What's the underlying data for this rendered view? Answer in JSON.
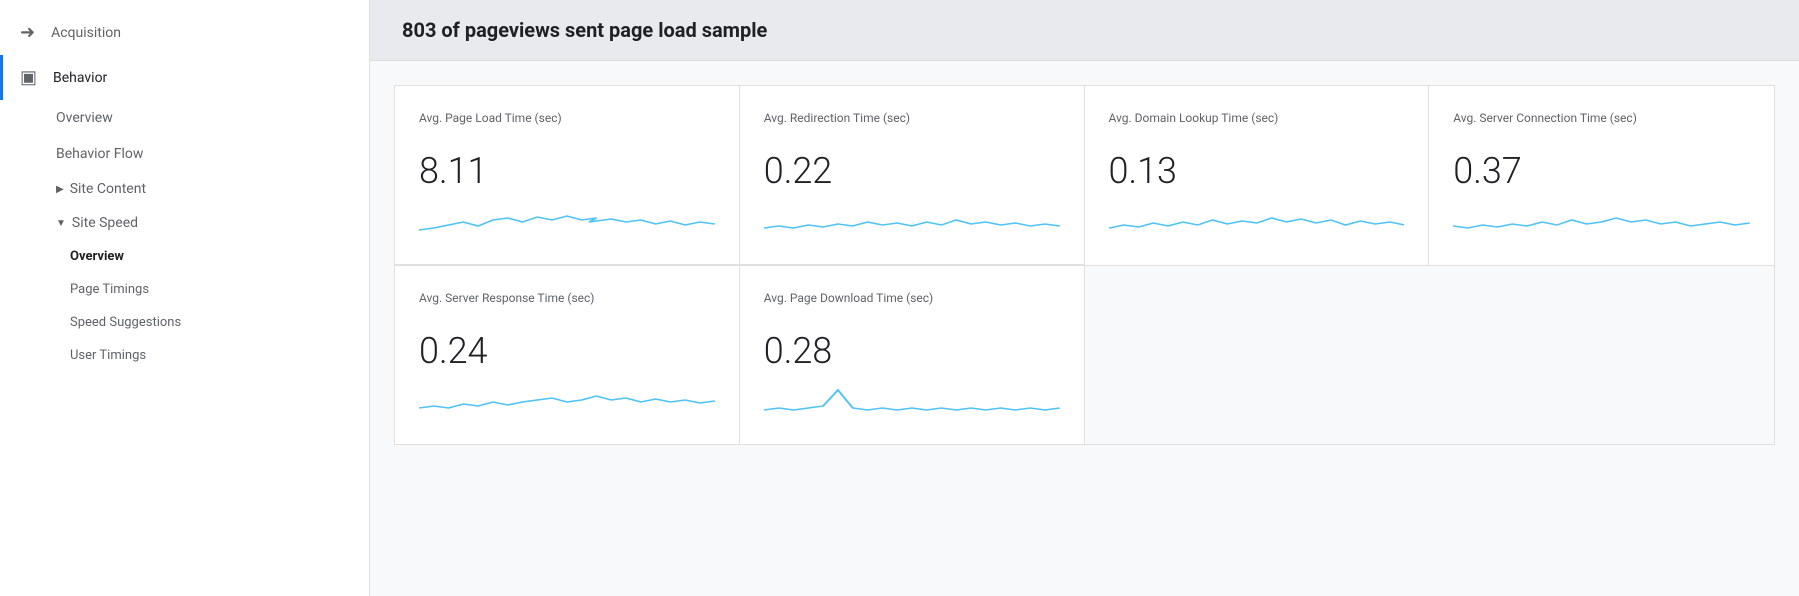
{
  "sidebar": {
    "acquisition": {
      "label": "Acquisition",
      "icon": "→"
    },
    "behavior": {
      "label": "Behavior",
      "icon": "⊞",
      "items": {
        "overview": "Overview",
        "behavior_flow": "Behavior Flow",
        "site_content": "Site Content",
        "site_speed": "Site Speed",
        "site_speed_sub": {
          "overview": "Overview",
          "page_timings": "Page Timings",
          "speed_suggestions": "Speed Suggestions",
          "user_timings": "User Timings"
        }
      }
    }
  },
  "main": {
    "page_header": "803 of pageviews sent page load sample",
    "metrics": [
      {
        "label": "Avg. Page Load Time (sec)",
        "value": "8.11",
        "sparkline_id": "spark1"
      },
      {
        "label": "Avg. Redirection Time (sec)",
        "value": "0.22",
        "sparkline_id": "spark2"
      },
      {
        "label": "Avg. Domain Lookup Time (sec)",
        "value": "0.13",
        "sparkline_id": "spark3"
      },
      {
        "label": "Avg. Server Connection Time (sec)",
        "value": "0.37",
        "sparkline_id": "spark4"
      }
    ],
    "metrics_bottom": [
      {
        "label": "Avg. Server Response Time (sec)",
        "value": "0.24",
        "sparkline_id": "spark5"
      },
      {
        "label": "Avg. Page Download Time (sec)",
        "value": "0.28",
        "sparkline_id": "spark6"
      }
    ]
  }
}
